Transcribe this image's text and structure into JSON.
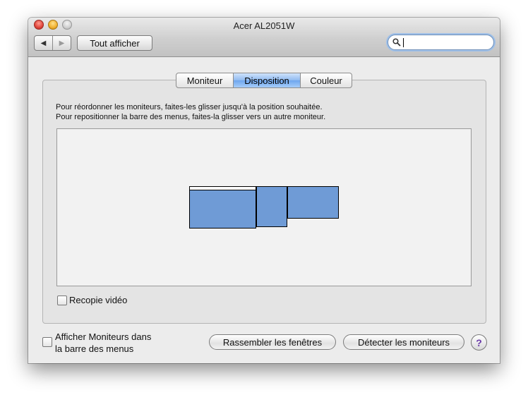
{
  "window": {
    "title": "Acer AL2051W"
  },
  "toolbar": {
    "back_glyph": "◀",
    "forward_glyph": "▶",
    "show_all_label": "Tout afficher",
    "search": {
      "placeholder": "",
      "value": ""
    }
  },
  "tabs": [
    {
      "label": "Moniteur",
      "selected": false
    },
    {
      "label": "Disposition",
      "selected": true
    },
    {
      "label": "Couleur",
      "selected": false
    }
  ],
  "instructions": {
    "line1": "Pour réordonner les moniteurs, faites-les glisser jusqu'à la position souhaitée.",
    "line2": "Pour repositionner la barre des menus, faites-la glisser vers un autre moniteur."
  },
  "mirror_checkbox": {
    "label": "Recopie vidéo",
    "checked": false
  },
  "menubar_checkbox": {
    "label_line1": "Afficher Moniteurs dans",
    "label_line2": "la barre des menus",
    "checked": false
  },
  "buttons": {
    "gather": "Rassembler les fenêtres",
    "detect": "Détecter les moniteurs",
    "help": "?"
  },
  "colors": {
    "monitor_fill": "#6f9bd6",
    "selected_tab": "#8fbaf0",
    "help_accent": "#6a3aa8"
  }
}
